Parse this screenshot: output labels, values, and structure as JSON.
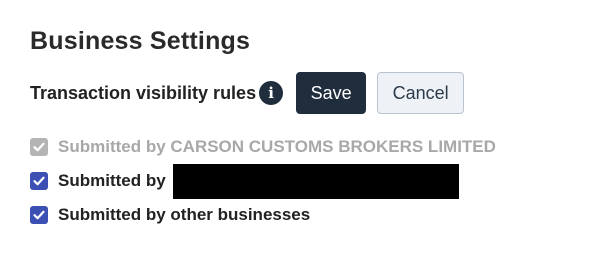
{
  "page": {
    "title": "Business Settings"
  },
  "rules": {
    "label": "Transaction visibility rules",
    "info_icon": "info-icon",
    "save_label": "Save",
    "cancel_label": "Cancel"
  },
  "options": [
    {
      "label": "Submitted by CARSON CUSTOMS BROKERS LIMITED",
      "checked": true,
      "disabled": true
    },
    {
      "label": "Submitted by",
      "checked": true,
      "disabled": false,
      "redacted": true
    },
    {
      "label": "Submitted by other businesses",
      "checked": true,
      "disabled": false
    }
  ],
  "colors": {
    "primary": "#1f2d3d",
    "checkbox_checked": "#3c50b4",
    "checkbox_disabled": "#b4b4b4",
    "disabled_text": "#a8a8a8"
  }
}
